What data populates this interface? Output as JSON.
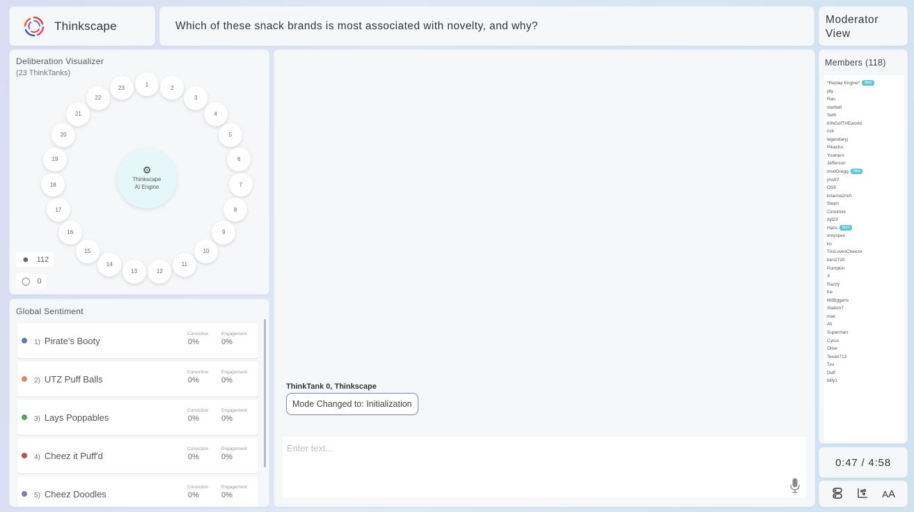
{
  "brand": {
    "name": "Thinkscape"
  },
  "question": "Which of these snack brands is most associated with novelty, and why?",
  "moderator_view": "Moderator View",
  "deliberation": {
    "title": "Deliberation Visualizer",
    "subtitle": "(23 ThinkTanks)",
    "nodes": [
      "1",
      "2",
      "3",
      "4",
      "5",
      "6",
      "7",
      "8",
      "9",
      "10",
      "11",
      "12",
      "13",
      "14",
      "15",
      "16",
      "17",
      "18",
      "19",
      "20",
      "21",
      "22",
      "23"
    ],
    "engine_line1": "Thinkscape",
    "engine_line2": "AI Engine",
    "participants": "112",
    "messages": "0"
  },
  "sentiment": {
    "title": "Global Sentiment",
    "conviction_label": "Conviction",
    "engagement_label": "Engagement",
    "items": [
      {
        "idx": "1)",
        "name": "Pirate's Booty",
        "color": "#5b7bb3",
        "conviction": "0%",
        "engagement": "0%"
      },
      {
        "idx": "2)",
        "name": "UTZ Puff Balls",
        "color": "#e08a5c",
        "conviction": "0%",
        "engagement": "0%"
      },
      {
        "idx": "3)",
        "name": "Lays Poppables",
        "color": "#5a9e66",
        "conviction": "0%",
        "engagement": "0%"
      },
      {
        "idx": "4)",
        "name": "Cheez it Puff'd",
        "color": "#c0504d",
        "conviction": "0%",
        "engagement": "0%"
      },
      {
        "idx": "5)",
        "name": "Cheez Doodles",
        "color": "#8a74c0",
        "conviction": "0%",
        "engagement": "0%"
      }
    ]
  },
  "chat": {
    "sender": "ThinkTank 0, Thinkscape",
    "message": "Mode Changed to: Initialization",
    "input_placeholder": "Enter text..."
  },
  "members": {
    "title": "Members (118)",
    "mod_label": "Mod",
    "list": [
      {
        "name": "*Replay Engine*",
        "mod": true
      },
      {
        "name": "jilly"
      },
      {
        "name": "Ran"
      },
      {
        "name": "starbell"
      },
      {
        "name": "Seth"
      },
      {
        "name": "KINGofTHEworld"
      },
      {
        "name": "rick"
      },
      {
        "name": "legendaryj"
      },
      {
        "name": "Pikachu"
      },
      {
        "name": "Yowners"
      },
      {
        "name": "Jefferson"
      },
      {
        "name": "modGregg",
        "mod": true
      },
      {
        "name": "jms87"
      },
      {
        "name": "OS8"
      },
      {
        "name": "brianna2rich"
      },
      {
        "name": "Steph"
      },
      {
        "name": "Cinnimini"
      },
      {
        "name": "dyl23"
      },
      {
        "name": "Hans",
        "mod": true
      },
      {
        "name": "xreyspex"
      },
      {
        "name": "kn"
      },
      {
        "name": "TrixLovesCheeze"
      },
      {
        "name": "ben2730"
      },
      {
        "name": "Pumpkin"
      },
      {
        "name": "X"
      },
      {
        "name": "Razzy"
      },
      {
        "name": "Ke"
      },
      {
        "name": "MrBiggens"
      },
      {
        "name": "Station7"
      },
      {
        "name": "mac"
      },
      {
        "name": "Ali"
      },
      {
        "name": "Superman"
      },
      {
        "name": "Cyrus"
      },
      {
        "name": "Olive"
      },
      {
        "name": "Texan713"
      },
      {
        "name": "Tsu"
      },
      {
        "name": "Duff"
      },
      {
        "name": "billy1"
      }
    ]
  },
  "timer": "0:47 / 4:58",
  "tools": [
    "database-icon",
    "scatter-chart-icon",
    "text-size-icon"
  ],
  "colors": {
    "accent": "#7a80b8",
    "mod_badge": "#5fc6d5",
    "engine_bg": "#e6f7fa"
  }
}
